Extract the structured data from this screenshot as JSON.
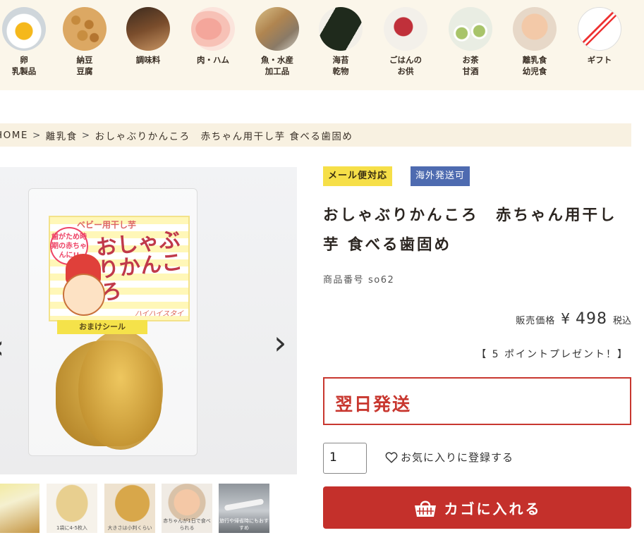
{
  "categories": [
    {
      "line1": "卵",
      "line2": "乳製品",
      "icon": "egg-rice-icon"
    },
    {
      "line1": "納豆",
      "line2": "豆腐",
      "icon": "soybean-icon"
    },
    {
      "line1": "調味料",
      "line2": "",
      "icon": "seasoning-icon"
    },
    {
      "line1": "肉・ハム",
      "line2": "",
      "icon": "meat-icon"
    },
    {
      "line1": "魚・水産",
      "line2": "加工品",
      "icon": "fish-icon"
    },
    {
      "line1": "海苔",
      "line2": "乾物",
      "icon": "seaweed-icon"
    },
    {
      "line1": "ごはんの",
      "line2": "お供",
      "icon": "umeboshi-icon"
    },
    {
      "line1": "お茶",
      "line2": "甘酒",
      "icon": "tea-icon"
    },
    {
      "line1": "離乳食",
      "line2": "幼児食",
      "icon": "baby-food-icon"
    },
    {
      "line1": "ギフト",
      "line2": "",
      "icon": "gift-icon"
    }
  ],
  "breadcrumb": {
    "home": "HOME",
    "sep": ">",
    "category": "離乳食",
    "current": "おしゃぶりかんころ　赤ちゃん用干し芋 食べる歯固め"
  },
  "product_image": {
    "package_top_text": "ベビー用干し芋",
    "package_title": "おしゃぶりかんころ",
    "package_badge": "歯がため時期の赤ちゃんに!!",
    "package_small": "ハイハイスタイ",
    "package_bonus": "おまけシール"
  },
  "thumbnails": [
    "thumb-package",
    "thumb-slices",
    "thumb-closeup",
    "thumb-baby",
    "thumb-airplane"
  ],
  "thumbnail_captions": [
    "",
    "1袋に4-5枚入",
    "大きさは小判くらい",
    "赤ちゃんが1日で食べられる",
    "旅行や帰省時にもおすすめ"
  ],
  "tags": {
    "mail": "メール便対応",
    "intl": "海外発送可"
  },
  "product": {
    "title": "おしゃぶりかんころ　赤ちゃん用干し芋 食べる歯固め",
    "code_label": "商品番号",
    "code": "so62",
    "price_label": "販売価格",
    "currency": "¥",
    "price": "498",
    "tax": "税込",
    "points": "【 5 ポイントプレゼント！】",
    "shipping": "翌日発送",
    "quantity": "1",
    "favorite": "お気に入りに登録する",
    "cart": "カゴに入れる"
  },
  "colors": {
    "accent": "#c4302b",
    "tag_mail": "#f6df48",
    "tag_intl": "#4e6bb0",
    "cat_bar": "#fbf6ea"
  }
}
